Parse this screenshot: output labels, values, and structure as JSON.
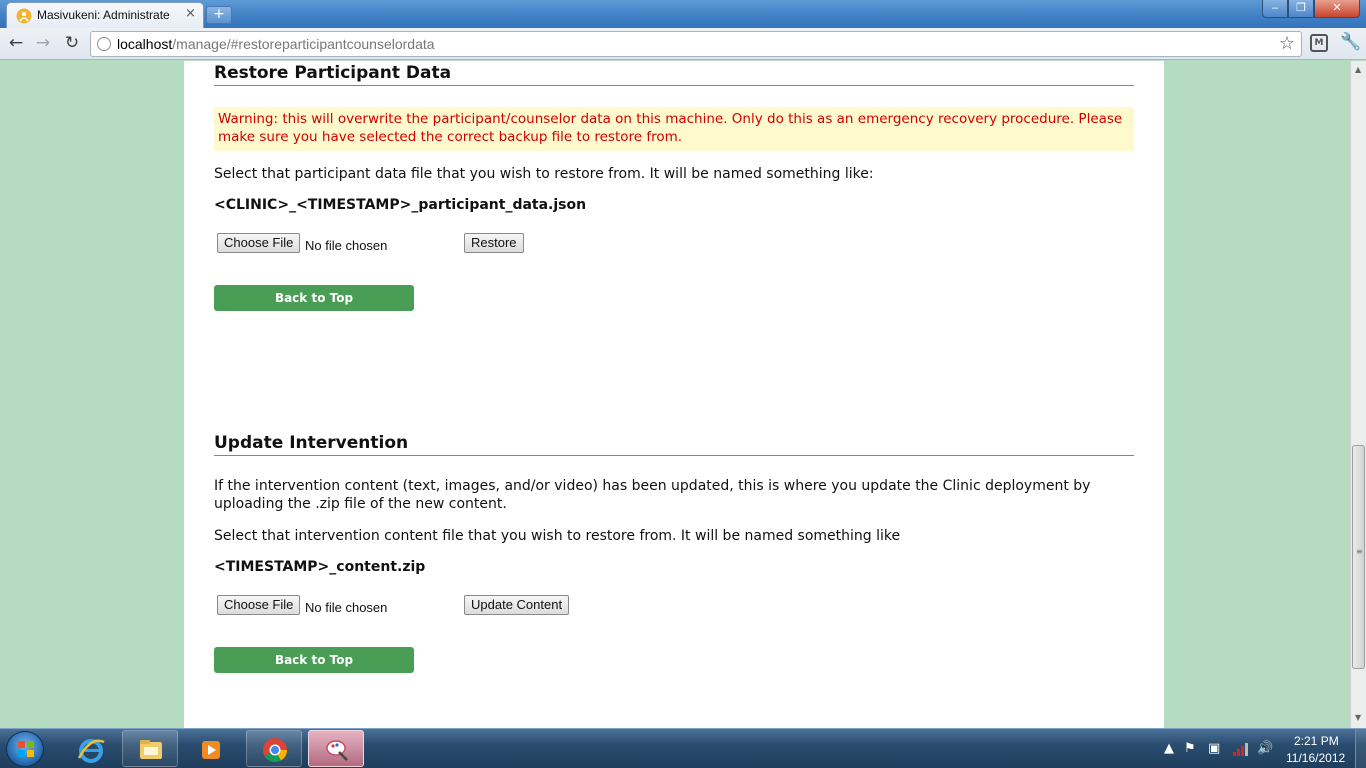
{
  "browser": {
    "tab_title": "Masivukeni: Administrate",
    "tab_close": "×",
    "new_tab": "+",
    "url_host": "localhost",
    "url_path": "/manage/#restoreparticipantcounselordata",
    "star": "☆",
    "window_min": "‒",
    "window_max": "❐",
    "window_close": "✕"
  },
  "restore_section": {
    "heading": "Restore Participant Data",
    "warning": "Warning: this will overwrite the participant/counselor data on this machine. Only do this as an emergency recovery procedure. Please make sure you have selected the correct backup file to restore from.",
    "instructions": "Select that participant data file that you wish to restore from. It will be named something like:",
    "filename_example": "<CLINIC>_<TIMESTAMP>_participant_data.json",
    "choose_file_label": "Choose File",
    "file_status": "No file chosen",
    "action_label": "Restore",
    "back_to_top": "Back to Top"
  },
  "update_section": {
    "heading": "Update Intervention",
    "description": "If the intervention content (text, images, and/or video) has been updated, this is where you update the Clinic deployment by uploading the .zip file of the new content.",
    "instructions": "Select that intervention content file that you wish to restore from. It will be named something like",
    "filename_example": "<TIMESTAMP>_content.zip",
    "choose_file_label": "Choose File",
    "file_status": "No file chosen",
    "action_label": "Update Content",
    "back_to_top": "Back to Top"
  },
  "taskbar": {
    "time": "2:21 PM",
    "date": "11/16/2012",
    "items": [
      "ie-icon",
      "explorer-icon",
      "media-player-icon",
      "chrome-icon",
      "paint-icon"
    ]
  },
  "colors": {
    "page_background": "#b5dcc1",
    "heading_rule": "#59a064",
    "warning_background": "#fffacd",
    "warning_text": "#d40000",
    "back_to_top_button": "#4a9d55"
  }
}
